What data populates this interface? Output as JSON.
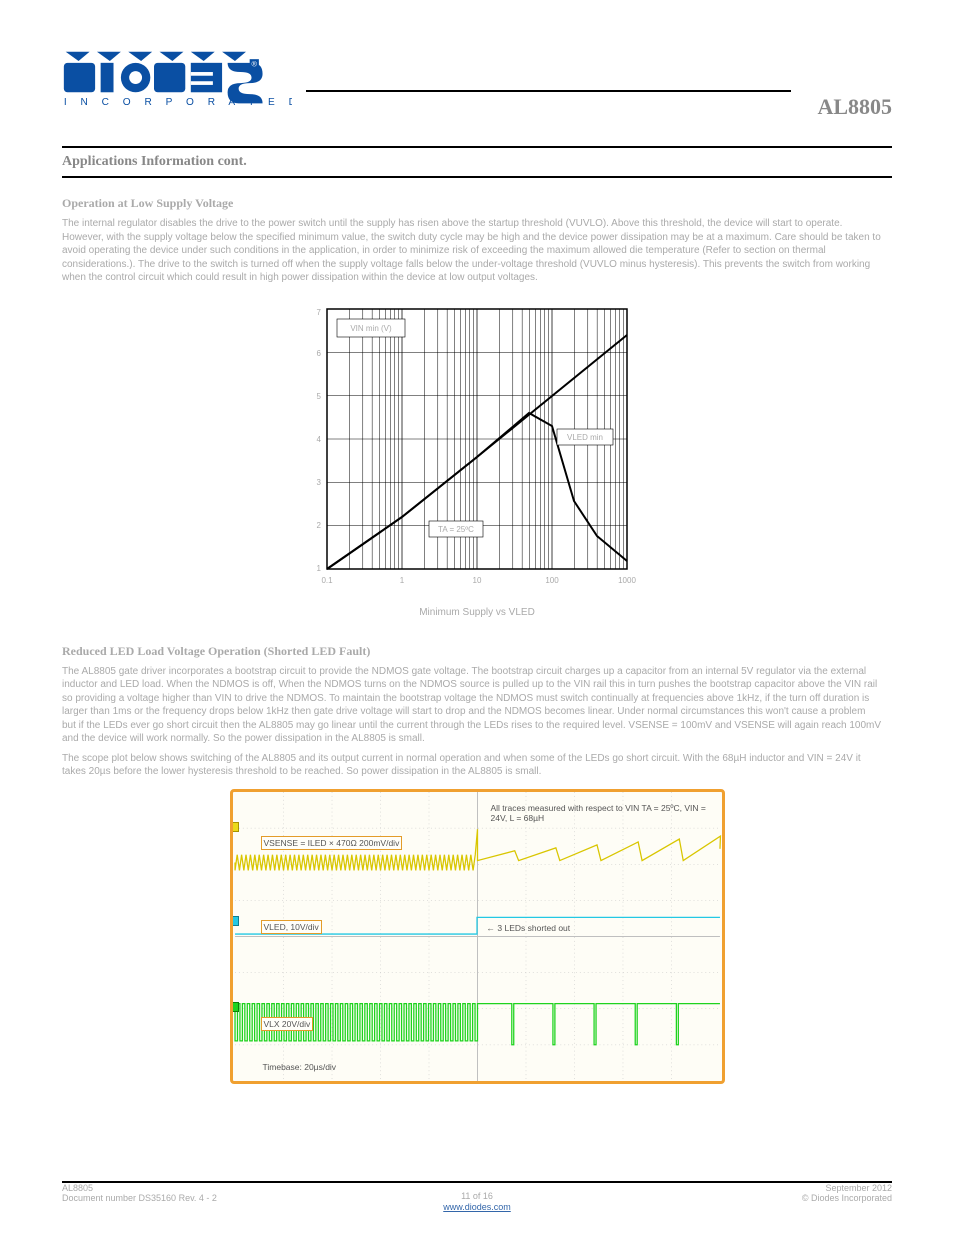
{
  "header": {
    "logo_text": "DIODES",
    "logo_sub": "I N C O R P O R A T E D",
    "part_no": "AL8805"
  },
  "section_title": "Applications Information cont.",
  "sec1": {
    "heading": "Operation at Low Supply Voltage",
    "para": "The internal regulator disables the drive to the power switch until the supply has risen above the startup threshold (VUVLO). Above this threshold, the device will start to operate. However, with the supply voltage below the specified minimum value, the switch duty cycle may be high and the device power dissipation may be at a maximum. Care should be taken to avoid operating the device under such conditions in the application, in order to minimize risk of exceeding the maximum allowed die temperature (Refer to section on thermal considerations.). The drive to the switch is turned off when the supply voltage falls below the under-voltage threshold (VUVLO minus hysteresis). This prevents the switch from working when the control circuit which could result in high power dissipation within the device at low output voltages."
  },
  "sec2": {
    "heading": "Reduced LED Load Voltage Operation (Shorted LED Fault)",
    "para": "The AL8805 gate driver incorporates a bootstrap circuit to provide the NDMOS gate voltage. The bootstrap circuit charges up a capacitor from an internal 5V regulator via the external inductor and LED load. When the NDMOS is off, When the NDMOS turns on the NDMOS source is pulled up to the VIN rail this in turn pushes the bootstrap capacitor above the VIN rail so providing a voltage higher than VIN to drive the NDMOS. To maintain the bootstrap voltage the NDMOS must switch continually at frequencies above 1kHz, if the turn off duration is larger than 1ms or the frequency drops below 1kHz then gate drive voltage will start to drop and the NDMOS becomes linear. Under normal circumstances this won't cause a problem but if the LEDs ever go short circuit then the AL8805 may go linear until the current through the LEDs rises to the required level. VSENSE = 100mV and VSENSE will again reach 100mV and the device will work normally. So the power dissipation in the AL8805 is small.",
    "para2": "The scope plot below shows switching of the AL8805 and its output current in normal operation and when some of the LEDs go short circuit. With the 68µH inductor and VIN = 24V it takes 20µs before the lower hysteresis threshold to be reached. So power dissipation in the AL8805 is small."
  },
  "chart_data": {
    "type": "line",
    "title": "Minimum Supply vs VLED",
    "xlabel": "",
    "ylabel": "",
    "x_scale": "log",
    "xlim": [
      0.1,
      1000
    ],
    "ylim": [
      1,
      7
    ],
    "x_ticks": [
      0.1,
      1,
      10,
      100,
      1000
    ],
    "y_ticks": [
      1,
      2,
      3,
      4,
      5,
      6,
      7
    ],
    "series": [
      {
        "name": "VIN min (V)",
        "x": [
          0.1,
          1,
          10,
          100,
          1000
        ],
        "y": [
          1.0,
          2.2,
          3.6,
          5.0,
          6.4
        ]
      },
      {
        "name": "VLED min",
        "x": [
          0.1,
          1,
          10,
          50,
          100,
          200,
          400,
          1000
        ],
        "y": [
          1.0,
          2.2,
          3.6,
          4.6,
          4.3,
          2.6,
          1.8,
          1.2
        ]
      }
    ],
    "annotations": [
      {
        "text": "VIN min (V)",
        "x": 0.3,
        "y": 6.5
      },
      {
        "text": "VLED min",
        "x": 120,
        "y": 4.4
      },
      {
        "text": "TA = 25ºC",
        "x": 8,
        "y": 2.1
      }
    ]
  },
  "scope": {
    "caption": "",
    "textbox_right": "All traces measured with respect to VIN\nTA = 25ºC, VIN = 24V, L = 68µH",
    "ch1_label": "VSENSE = ILED × 470Ω    200mV/div",
    "ch2_label": "VLED,  10V/div",
    "ch3_label": "VLX  20V/div",
    "event_label": "3 LEDs shorted out",
    "timebase": "Timebase: 20µs/div",
    "channels": [
      {
        "name": "VSENSE",
        "color": "#d9c600",
        "div": "200mV/div"
      },
      {
        "name": "VLED",
        "color": "#23c8e4",
        "div": "10V/div"
      },
      {
        "name": "VLX",
        "color": "#1ed31e",
        "div": "20V/div"
      }
    ]
  },
  "footer": {
    "left_line1": "AL8805",
    "left_line2": "Document number DS35160 Rev. 4 - 2",
    "mid_line1": "11 of 16",
    "mid_line2": "www.diodes.com",
    "right_line1": "September 2012",
    "right_line2": "© Diodes Incorporated"
  }
}
